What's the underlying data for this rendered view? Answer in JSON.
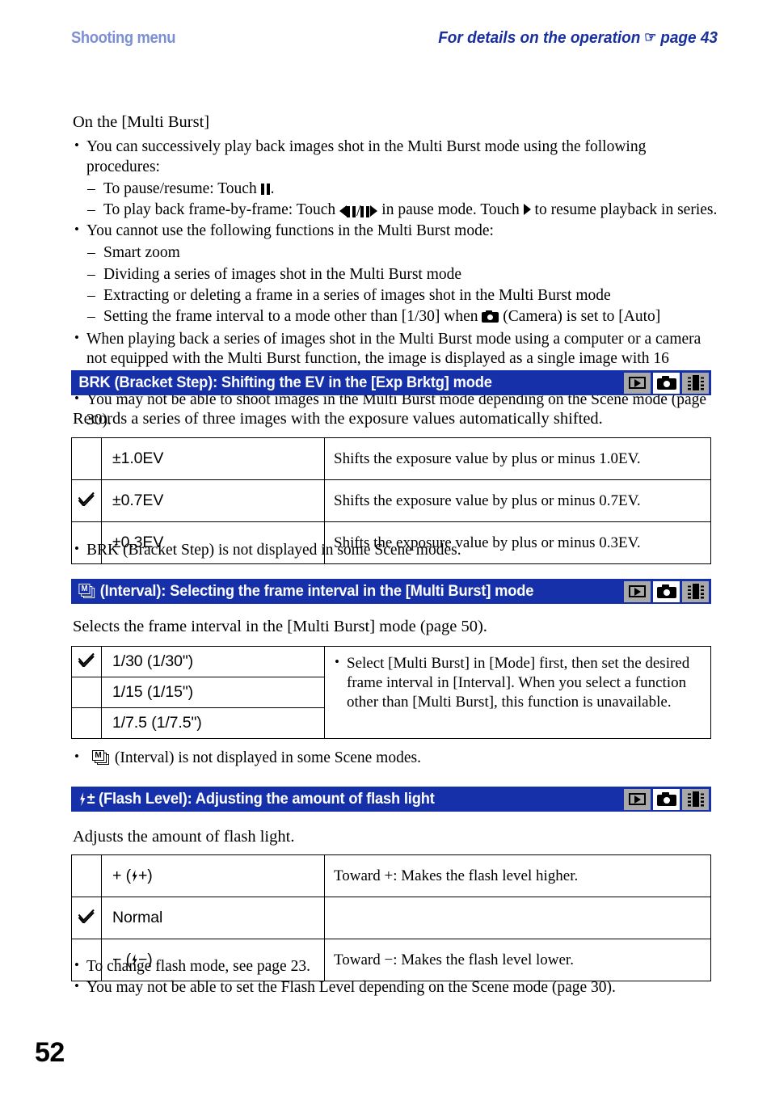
{
  "header": {
    "left_title": "Shooting menu",
    "right_title_pre": "For details on the operation",
    "hand_icon": "pointing-hand-icon",
    "right_title_post": "page 43"
  },
  "multi_burst_notes": {
    "subhead": "On the [Multi Burst]",
    "bullet1": "You can successively play back images shot in the Multi Burst mode using the following procedures:",
    "dash1_pre": "To pause/resume: Touch",
    "dash1_post": ".",
    "dash2_pre": "To play back frame-by-frame: Touch",
    "dash2_mid": "in pause mode. Touch",
    "dash2_post": "to resume playback in series.",
    "bullet2": "You cannot use the following functions in the Multi Burst mode:",
    "dash3": "Smart zoom",
    "dash4": "Dividing a series of images shot in the Multi Burst mode",
    "dash5": "Extracting or deleting a frame in a series of images shot in the Multi Burst mode",
    "dash6_pre": "Setting the frame interval to a mode other than [1/30] when",
    "dash6_post": "(Camera) is set to [Auto]",
    "bullet3": "When playing back a series of images shot in the Multi Burst mode using a computer or a camera not equipped with the Multi Burst function, the image is displayed as a single image with 16 frames.",
    "bullet4": "You may not be able to shoot images in the Multi Burst mode depending on the Scene mode (page 30)."
  },
  "section_brk": {
    "heading": "BRK (Bracket Step): Shifting the EV in the [Exp Brktg] mode",
    "intro": "Records a series of three images with the exposure values automatically shifted.",
    "badges": [
      {
        "icon": "playback-icon",
        "state": "inactive"
      },
      {
        "icon": "camera-icon",
        "state": "active"
      },
      {
        "icon": "movie-film-icon",
        "state": "inactive"
      }
    ],
    "rows": [
      {
        "checked": false,
        "option": "±1.0EV",
        "desc": "Shifts the exposure value by plus or minus 1.0EV."
      },
      {
        "checked": true,
        "option": "±0.7EV",
        "desc": "Shifts the exposure value by plus or minus 0.7EV."
      },
      {
        "checked": false,
        "option": "±0.3EV",
        "desc": "Shifts the exposure value by plus or minus 0.3EV."
      }
    ],
    "note": "BRK (Bracket Step) is not displayed in some Scene modes."
  },
  "section_interval": {
    "heading_icon": "multi-burst-icon",
    "heading": "(Interval): Selecting the frame interval in the [Multi Burst] mode",
    "intro": "Selects the frame interval in the [Multi Burst] mode (page 50).",
    "badges": [
      {
        "icon": "playback-icon",
        "state": "inactive"
      },
      {
        "icon": "camera-icon",
        "state": "active"
      },
      {
        "icon": "movie-film-icon",
        "state": "inactive"
      }
    ],
    "rows": [
      {
        "checked": true,
        "option": "1/30 (1/30\")"
      },
      {
        "checked": false,
        "option": "1/15 (1/15\")"
      },
      {
        "checked": false,
        "option": "1/7.5 (1/7.5\")"
      }
    ],
    "desc": "Select [Multi Burst] in [Mode] first, then set the desired frame interval in [Interval]. When you select a function other than [Multi Burst], this function is unavailable.",
    "note_icon": "multi-burst-icon",
    "note": "(Interval) is not displayed in some Scene modes."
  },
  "section_flash": {
    "heading_icon": "flash-plus-minus-icon",
    "heading": "(Flash Level): Adjusting the amount of flash light",
    "intro": "Adjusts the amount of flash light.",
    "badges": [
      {
        "icon": "playback-icon",
        "state": "inactive"
      },
      {
        "icon": "camera-icon",
        "state": "active"
      },
      {
        "icon": "movie-film-icon",
        "state": "inactive"
      }
    ],
    "rows": [
      {
        "checked": false,
        "option_pre": "+ (",
        "option_icon": "flash-icon",
        "option_post": "+)",
        "desc": "Toward +: Makes the flash level higher."
      },
      {
        "checked": true,
        "option_plain": "Normal",
        "desc": ""
      },
      {
        "checked": false,
        "option_pre": "− (",
        "option_icon": "flash-icon",
        "option_post": "−)",
        "desc": "Toward −: Makes the flash level lower."
      }
    ],
    "note1": "To change flash mode, see page 23.",
    "note2": "You may not be able to set the Flash Level depending on the Scene mode (page 30)."
  },
  "footer": {
    "page_number": "52"
  },
  "colors": {
    "header_left": "#7b8fd6",
    "header_right": "#1a2f9e",
    "section_bar": "#1530a8",
    "badge_inactive": "#a8a8a8",
    "badge_active": "#ffffff"
  }
}
